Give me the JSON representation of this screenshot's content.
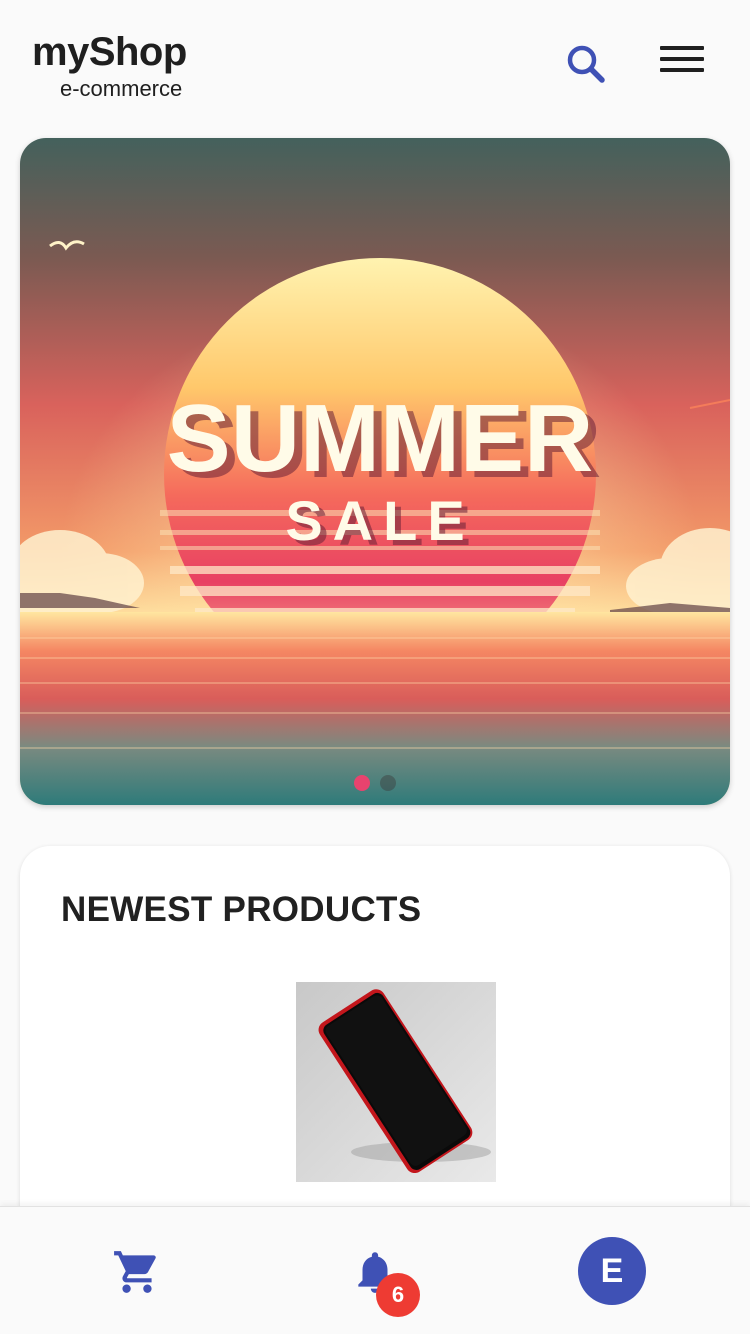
{
  "app": {
    "title": "myShop",
    "subtitle": "e-commerce"
  },
  "header": {
    "search_icon": "search-icon",
    "menu_icon": "hamburger-menu-icon"
  },
  "banner": {
    "headline": "SUMMER",
    "subheadline": "SALE",
    "slide_count": 2,
    "active_slide": 1
  },
  "products": {
    "title": "NEWEST PRODUCTS",
    "items": [
      {
        "image": "red smartphone"
      }
    ]
  },
  "bottom_nav": {
    "cart_icon": "cart-icon",
    "bell_icon": "bell-icon",
    "notification_count": "6",
    "avatar_initial": "E"
  },
  "colors": {
    "accent": "#3f51b5",
    "badge": "#ee3b33",
    "active_dot": "#e8436e"
  }
}
